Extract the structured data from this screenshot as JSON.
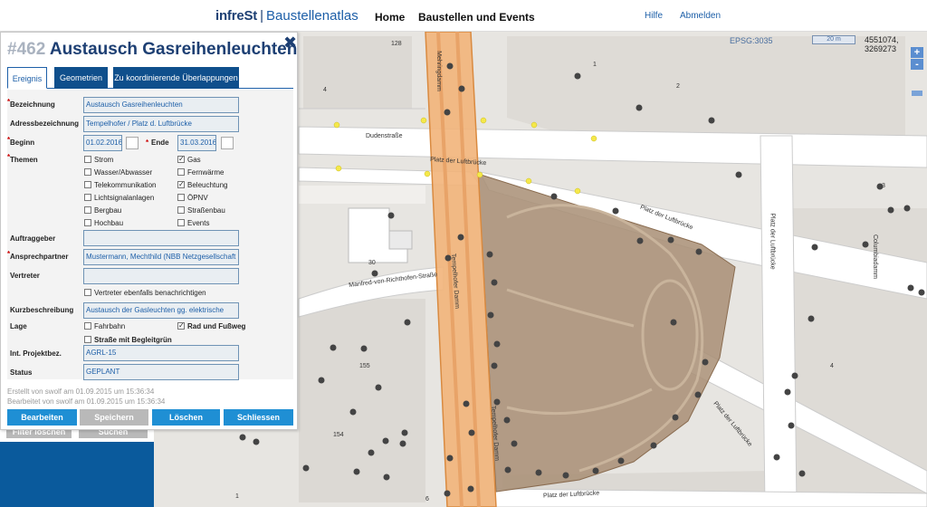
{
  "header": {
    "brand_prefix": "infreSt",
    "brand_separator": "|",
    "brand_name": "Baustellenatlas",
    "nav": [
      "Home",
      "Baustellen und Events"
    ],
    "links": [
      "Hilfe",
      "Abmelden"
    ]
  },
  "map": {
    "epsg": "EPSG:3035",
    "scale": "20 m",
    "coords": "4551074, 3269273",
    "zoom_in": "+",
    "zoom_out": "-",
    "labels": {
      "mehringdamm": "Mehringdamm",
      "dudenstrasse": "Dudenstraße",
      "platz_top": "Platz der Luftbrücke",
      "platz_right": "Platz der Luftbrücke",
      "platz_vertical": "Platz der Luftbrücke",
      "platz_bottom": "Platz der Luftbrücke",
      "platz_right_lower": "Platz der Luftbrücke",
      "manfred": "Manfred-von-Richthofen-Straße",
      "tempelhofer_1": "Tempelhofer Damm",
      "tempelhofer_2": "Tempelhofer Damm",
      "columbiadamm": "Columbiadamm"
    },
    "house_numbers": [
      "128",
      "1",
      "4",
      "2",
      "3",
      "30",
      "155",
      "154",
      "4",
      "1",
      "6"
    ]
  },
  "dialog": {
    "id": "#462",
    "title": "Austausch Gasreihenleuchten",
    "close_icon": "close-icon",
    "tabs": [
      "Ereignis",
      "Geometrien",
      "Zu koordinierende Überlappungen"
    ],
    "active_tab": "Ereignis",
    "fields": {
      "bezeichnung_label": "Bezeichnung",
      "bezeichnung": "Austausch Gasreihenleuchten",
      "adresse_label": "Adressbezeichnung",
      "adresse": "Tempelhofer / Platz d. Luftbrücke",
      "beginn_label": "Beginn",
      "beginn": "01.02.2016",
      "ende_label": "Ende",
      "ende": "31.03.2016",
      "themen_label": "Themen",
      "themen": [
        {
          "label": "Strom",
          "checked": false
        },
        {
          "label": "Gas",
          "checked": true
        },
        {
          "label": "Wasser/Abwasser",
          "checked": false
        },
        {
          "label": "Fernwärme",
          "checked": false
        },
        {
          "label": "Telekommunikation",
          "checked": false
        },
        {
          "label": "Beleuchtung",
          "checked": true
        },
        {
          "label": "Lichtsignalanlagen",
          "checked": false
        },
        {
          "label": "ÖPNV",
          "checked": false
        },
        {
          "label": "Bergbau",
          "checked": false
        },
        {
          "label": "Straßenbau",
          "checked": false
        },
        {
          "label": "Hochbau",
          "checked": false
        },
        {
          "label": "Events",
          "checked": false
        }
      ],
      "auftraggeber_label": "Auftraggeber",
      "auftraggeber": "",
      "ansprechpartner_label": "Ansprechpartner",
      "ansprechpartner": "Mustermann, Mechthild (NBB Netzgesellschaft",
      "vertreter_label": "Vertreter",
      "vertreter": "",
      "vertreter_notify": "Vertreter ebenfalls benachrichtigen",
      "kurzbeschreibung_label": "Kurzbeschreibung",
      "kurzbeschreibung": "Austausch der Gasleuchten gg. elektrische",
      "lage_label": "Lage",
      "lage": [
        {
          "label": "Fahrbahn",
          "checked": false
        },
        {
          "label": "Rad und Fußweg",
          "checked": true
        },
        {
          "label": "Straße mit Begleitgrün",
          "checked": false
        }
      ],
      "projektbez_label": "Int. Projektbez.",
      "projektbez": "AGRL-15",
      "status_label": "Status",
      "status": "GEPLANT"
    },
    "created": "Erstellt von swolf am 01.09.2015 um 15:36:34",
    "edited": "Bearbeitet von swolf am 01.09.2015 um 15:36:34",
    "buttons": [
      "Bearbeiten",
      "Speichern",
      "Löschen",
      "Schliessen"
    ]
  },
  "background_panel": {
    "buttons": [
      "Filter löschen",
      "Suchen"
    ]
  }
}
